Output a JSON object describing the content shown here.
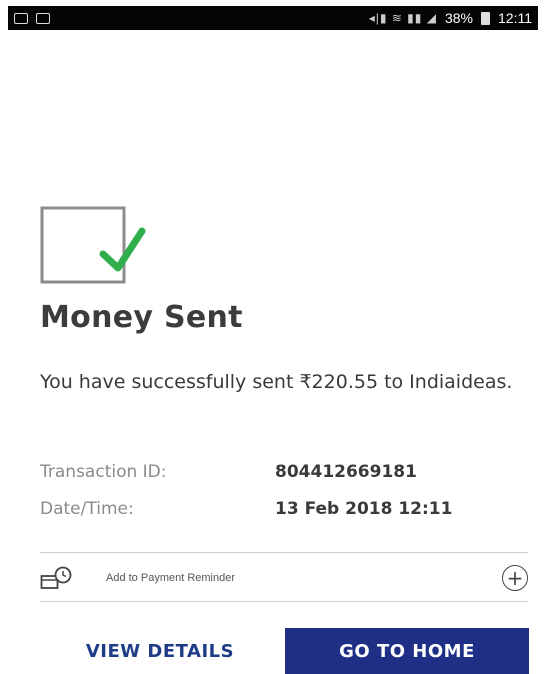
{
  "status_bar": {
    "battery": "38%",
    "time": "12:11"
  },
  "screen": {
    "title": "Money Sent",
    "message": "You have successfully sent ₹220.55 to Indiaideas.",
    "details": [
      {
        "label": "Transaction ID:",
        "value": "804412669181"
      },
      {
        "label": "Date/Time:",
        "value": "13 Feb 2018 12:11"
      }
    ],
    "reminder_label": "Add to Payment Reminder",
    "add_icon": "+"
  },
  "actions": {
    "view_details": "VIEW DETAILS",
    "go_to_home": "GO TO HOME"
  },
  "colors": {
    "accent": "#1f2f85",
    "check": "#2fae4b",
    "status_bar": "#050505"
  },
  "icons": [
    "media-icon",
    "image-icon",
    "signal-icon",
    "wifi-icon",
    "battery-icon",
    "checkbox-check-icon",
    "payment-reminder-icon",
    "add-circle-icon"
  ]
}
